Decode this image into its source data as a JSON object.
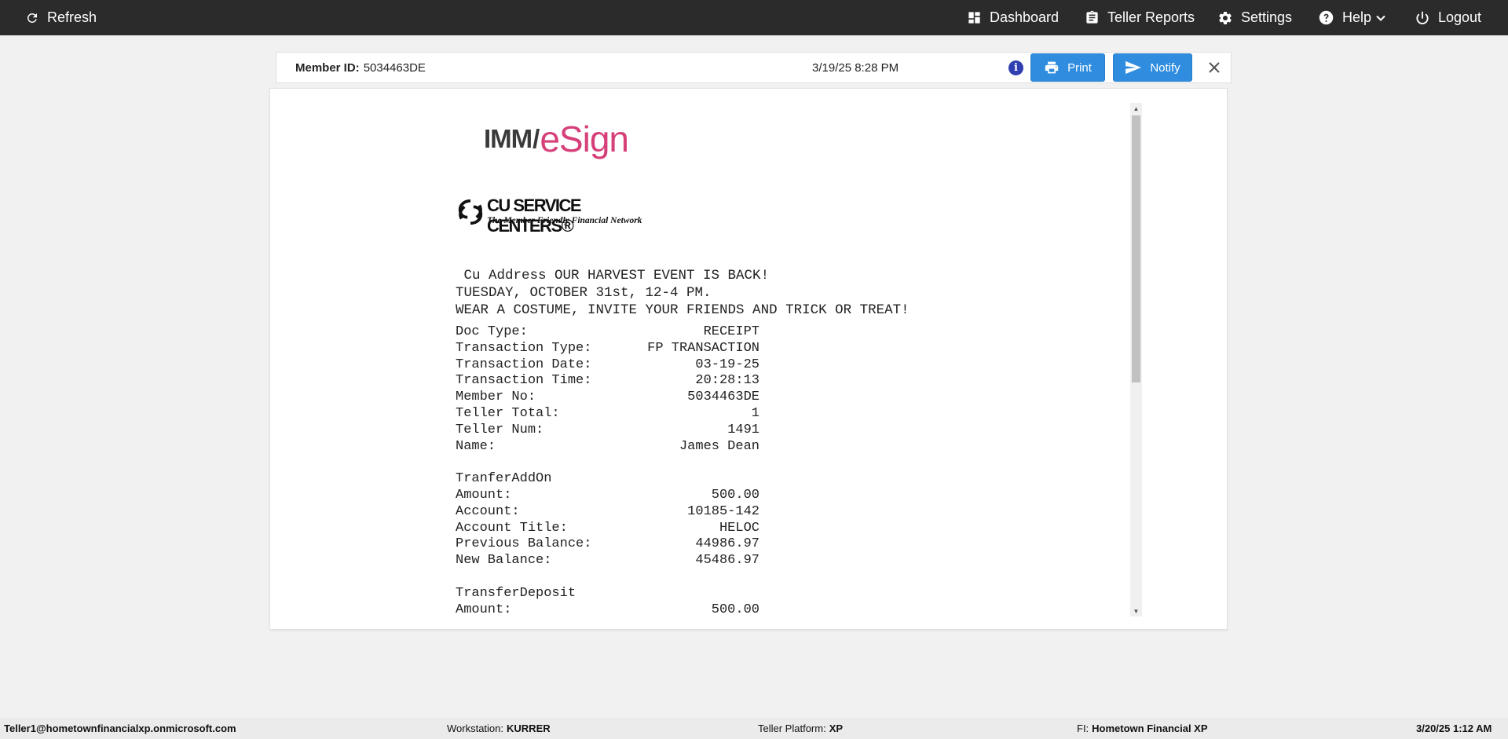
{
  "topbar": {
    "refresh": "Refresh",
    "dashboard": "Dashboard",
    "teller_reports": "Teller Reports",
    "settings": "Settings",
    "help": "Help",
    "logout": "Logout"
  },
  "member_bar": {
    "member_id_label": "Member ID:",
    "member_id": "5034463DE",
    "datetime": "3/19/25 8:28 PM",
    "print_label": "Print",
    "notify_label": "Notify"
  },
  "document": {
    "logo_imm": "IMM",
    "logo_slash": "/",
    "logo_esign": "eSign",
    "cu_name": "CU SERVICE CENTERS®",
    "cu_tagline": "The Member Friendly Financial Network",
    "announcement": [
      " Cu Address OUR HARVEST EVENT IS BACK!",
      "TUESDAY, OCTOBER 31st, 12-4 PM.",
      "WEAR A COSTUME, INVITE YOUR FRIENDS AND TRICK OR TREAT!"
    ],
    "fields": [
      {
        "label": "Doc Type:",
        "value": "RECEIPT"
      },
      {
        "label": "Transaction Type:",
        "value": "FP TRANSACTION"
      },
      {
        "label": "Transaction Date:",
        "value": "03-19-25"
      },
      {
        "label": "Transaction Time:",
        "value": "20:28:13"
      },
      {
        "label": "Member No:",
        "value": "5034463DE"
      },
      {
        "label": "Teller Total:",
        "value": "1"
      },
      {
        "label": "Teller Num:",
        "value": "1491"
      },
      {
        "label": "Name:",
        "value": "James Dean"
      }
    ],
    "sections": [
      {
        "heading": "TranferAddOn",
        "fields": [
          {
            "label": "Amount:",
            "value": "500.00"
          },
          {
            "label": "Account:",
            "value": "10185-142"
          },
          {
            "label": "Account Title:",
            "value": "HELOC"
          },
          {
            "label": "Previous Balance:",
            "value": "44986.97"
          },
          {
            "label": "New Balance:",
            "value": "45486.97"
          }
        ]
      },
      {
        "heading": "TransferDeposit",
        "fields": [
          {
            "label": "Amount:",
            "value": "500.00"
          }
        ]
      }
    ]
  },
  "statusbar": {
    "user": "Teller1@hometownfinancialxp.onmicrosoft.com",
    "workstation_label": "Workstation:",
    "workstation": "KURRER",
    "platform_label": "Teller Platform:",
    "platform": "XP",
    "fi_label": "FI:",
    "fi": "Hometown Financial XP",
    "datetime": "3/20/25 1:12 AM"
  },
  "colors": {
    "topbar_bg": "#2b2b2b",
    "button_blue": "#2f8cdf",
    "info_icon": "#2f3fb0",
    "esign_pink": "#d6407a"
  }
}
